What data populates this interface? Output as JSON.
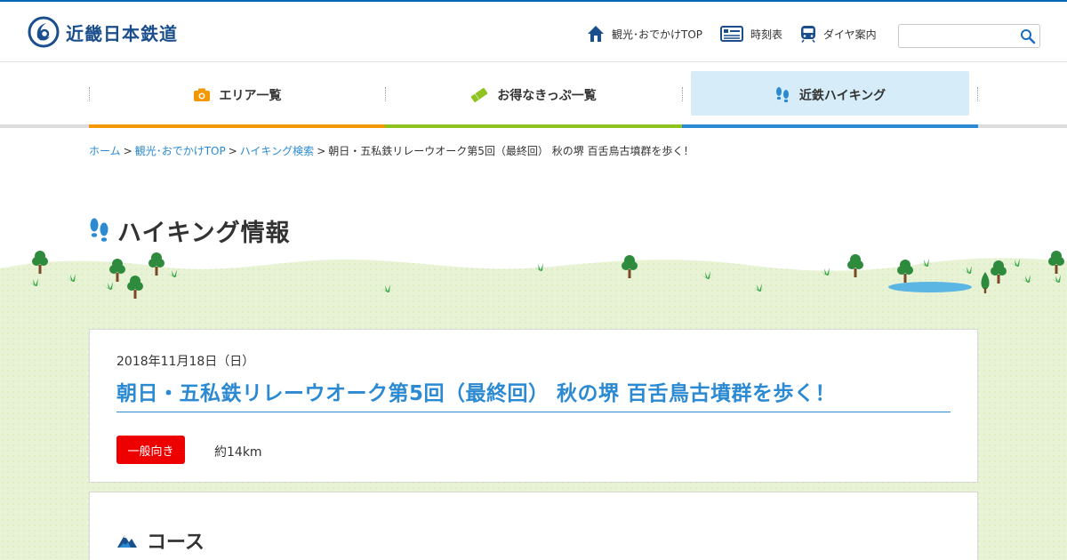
{
  "header": {
    "logo_text": "近畿日本鉄道",
    "links": [
      {
        "label": "観光･おでかけTOP",
        "icon": "home-icon"
      },
      {
        "label": "時刻表",
        "icon": "timetable-icon"
      },
      {
        "label": "ダイヤ案内",
        "icon": "train-icon"
      }
    ],
    "search": {
      "value": "",
      "placeholder": ""
    }
  },
  "nav": {
    "items": [
      {
        "label": "エリア一覧",
        "icon": "camera-icon",
        "bar_color": "#f39800"
      },
      {
        "label": "お得なきっぷ一覧",
        "icon": "ticket-icon",
        "bar_color": "#8fc31f"
      },
      {
        "label": "近鉄ハイキング",
        "icon": "footprints-icon",
        "bar_color": "#2b8ad2",
        "active": true
      }
    ]
  },
  "breadcrumb": {
    "items": [
      "ホーム",
      "観光･おでかけTOP",
      "ハイキング検索"
    ],
    "current": "朝日・五私鉄リレーウオーク第5回（最終回） 秋の堺 百舌鳥古墳群を歩く！"
  },
  "page": {
    "title": "ハイキング情報"
  },
  "event": {
    "date": "2018年11月18日（日）",
    "title": "朝日・五私鉄リレーウオーク第5回（最終回） 秋の堺 百舌鳥古墳群を歩く！",
    "level": "一般向き",
    "distance": "約14km"
  },
  "course": {
    "heading": "コース"
  },
  "colors": {
    "brand": "#0068b7",
    "link": "#2b8ad2",
    "badge": "#ee0000",
    "grass": "#e6f2d2"
  }
}
